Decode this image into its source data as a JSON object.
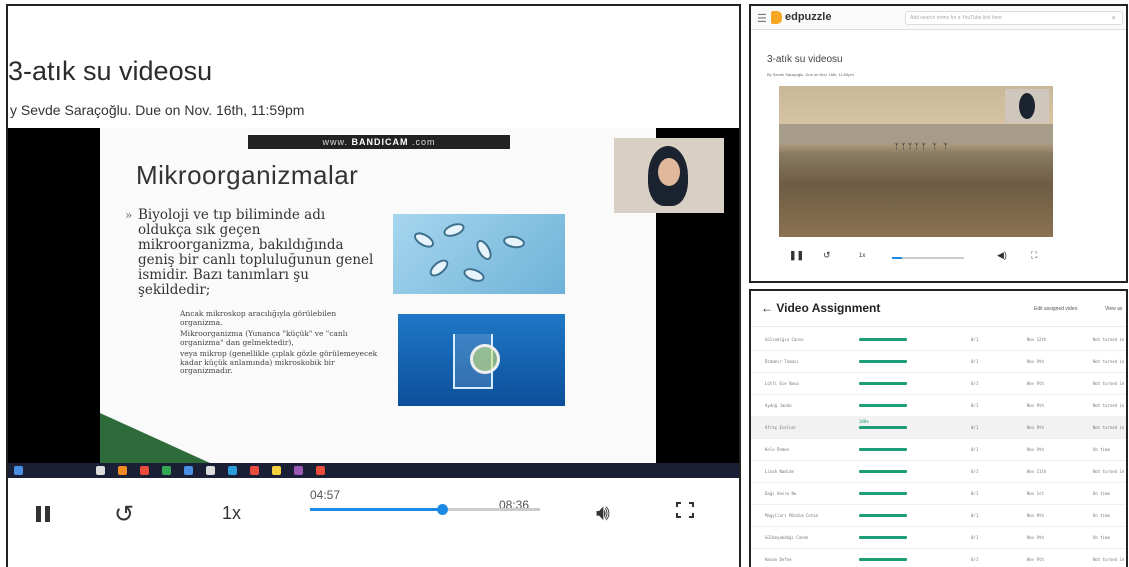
{
  "left": {
    "title": "3-atık su videosu",
    "subtitle": "y Sevde Saraçoğlu. Due on Nov. 16th, 11:59pm",
    "slide": {
      "recorder_text": "BANDICAM",
      "heading": "Mikroorganizmalar",
      "bullet": "Biyoloji ve tıp biliminde adı oldukça sık geçen mikroorganizma, bakıldığında geniş bir canlı topluluğunun genel ismidir. Bazı tanımları şu şekildedir;",
      "subpoints": [
        "Ancak mikroskop aracılığıyla görülebilen organizma.",
        "Mikroorganizma (Yunanca \"küçük\" ve \"canlı organizma\" dan gelmektedir),",
        "veya mikrop (genellikle çıplak gözle görülemeyecek kadar küçük anlamında) mikroskobik bir organizmadır."
      ]
    },
    "controls": {
      "speed": "1x",
      "time_current": "04:57",
      "time_total": "08:36",
      "progress_fraction": 0.576
    }
  },
  "right_top": {
    "app": "edpuzzle",
    "search_placeholder": "Add search terms for a YouTube link here",
    "video_title": "3-atık su videosu",
    "video_sub": "By Sevde Saraçoğlu. Due on Nov. 16th, 11:59pm",
    "progress_fraction": 0.14
  },
  "right_bottom": {
    "header": "Video Assignment",
    "edit_link": "Edit assigned video",
    "view_link": "View as",
    "rows": [
      {
        "name": "Gülsadiğın Cansu",
        "score": "0/1",
        "due": "Nov 12th",
        "status": "Not turned in"
      },
      {
        "name": "Özdemir Taması",
        "score": "0/1",
        "due": "Nov 9th",
        "status": "Not turned in"
      },
      {
        "name": "Lütfi Ece Nasa",
        "score": "0/1",
        "due": "Nov 9th",
        "status": "Not turned in"
      },
      {
        "name": "Aydoğ Janda",
        "score": "0/1",
        "due": "Nov 9th",
        "status": "Not turned in"
      },
      {
        "name": "Afraş Ecelnar",
        "score": "0/1",
        "due": "Nov 9th",
        "status": "Not turned in",
        "pct": "100%"
      },
      {
        "name": "Kolo Önmen",
        "score": "0/1",
        "due": "Nov 9th",
        "status": "On time"
      },
      {
        "name": "Linah Nadide",
        "score": "0/1",
        "due": "Nov 11th",
        "status": "Not turned in"
      },
      {
        "name": "Dağı Hasra Nu",
        "score": "0/1",
        "due": "Nov 1st",
        "status": "On time"
      },
      {
        "name": "Magyiları Mösdim Cetan",
        "score": "0/1",
        "due": "Nov 9th",
        "status": "On time"
      },
      {
        "name": "Gülbeyakdağı Cande",
        "score": "0/1",
        "due": "Nov 9th",
        "status": "On time"
      },
      {
        "name": "Hasan Defne",
        "score": "0/1",
        "due": "Nov 9th",
        "status": "Not turned in"
      }
    ]
  }
}
